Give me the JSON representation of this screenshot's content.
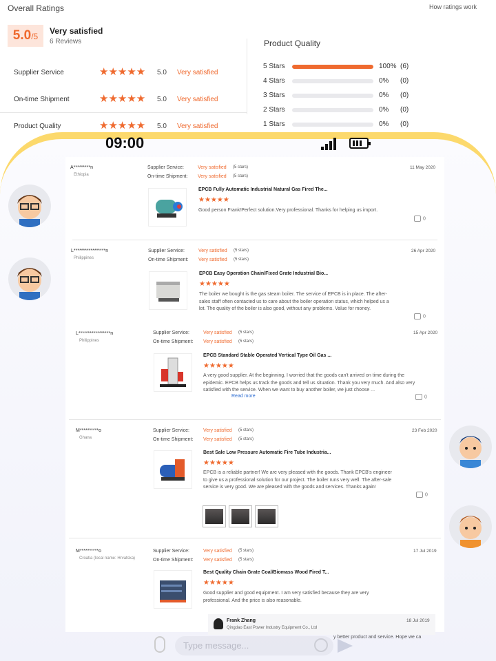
{
  "overall": {
    "title": "Overall Ratings",
    "how_link": "How ratings work",
    "score": "5.0",
    "score_max": "/5",
    "verdict": "Very satisfied",
    "reviews_count": "6 Reviews"
  },
  "criteria": [
    {
      "label": "Supplier Service",
      "stars": 5,
      "value": "5.0",
      "text": "Very satisfied"
    },
    {
      "label": "On-time Shipment",
      "stars": 5,
      "value": "5.0",
      "text": "Very satisfied"
    },
    {
      "label": "Product Quality",
      "stars": 5,
      "value": "5.0",
      "text": "Very satisfied"
    }
  ],
  "product_quality": {
    "title": "Product Quality",
    "rows": [
      {
        "label": "5 Stars",
        "fraction": 1.0,
        "pct": "100%",
        "count": "(6)"
      },
      {
        "label": "4 Stars",
        "fraction": 0,
        "pct": "0%",
        "count": "(0)"
      },
      {
        "label": "3 Stars",
        "fraction": 0,
        "pct": "0%",
        "count": "(0)"
      },
      {
        "label": "2 Stars",
        "fraction": 0,
        "pct": "0%",
        "count": "(0)"
      },
      {
        "label": "1 Stars",
        "fraction": 0,
        "pct": "0%",
        "count": "(0)"
      }
    ]
  },
  "status_bar": {
    "time": "09:00"
  },
  "labels": {
    "supplier_service": "Supplier Service:",
    "ontime_shipment": "On-time Shipment:",
    "very_satisfied": "Very satisfied",
    "five_stars": "(5 stars)",
    "read_more": "Read more"
  },
  "reviews": [
    {
      "user": "A*********n",
      "country": "Ethiopia",
      "date": "11 May 2020",
      "product": "EPCB Fully Automatic Industrial Natural Gas Fired The...",
      "text": "Good person Frank!Perfect solution.Very professional. Thanks for helping us import.",
      "likes": "0"
    },
    {
      "user": "L*****************n",
      "country": "Philippines",
      "date": "26 Apr 2020",
      "product": "EPCB Easy Operation Chain/Fixed Grate Industrial Bio...",
      "text": "The boiler we bought is the gas steam boiler. The service of EPCB is in place. The after-sales staff often contacted us to care about the boiler operation status, which helped us a lot. The quality of the boiler is also good, without any problems. Value for money.",
      "likes": "0"
    },
    {
      "user": "L*****************n",
      "country": "Philippines",
      "date": "15 Apr 2020",
      "product": "EPCB Standard Stable Operated Vertical Type Oil Gas ...",
      "text": "A very good supplier. At the beginning, I worried that the goods can't arrived on time during the epidemic. EPCB helps us track the goods and tell us situation.  Thank you very much. And also very satisfied with the service. When we want to buy another boiler, we just choose ...",
      "likes": "0"
    },
    {
      "user": "M**********o",
      "country": "Ghana",
      "date": "23 Feb 2020",
      "product": "Best Sale Low Pressure Automatic Fire Tube Industria...",
      "text": "EPCB is a reliable partner! We are very pleased with the goods. Thank EPCB's engineer to give us a professional solution for our project. The boiler runs very well. The after-sale service is very good. We are pleased with the goods and services. Thanks again!",
      "likes": "0"
    },
    {
      "user": "M**********o",
      "country": "Croatia (local name: Hrvatska)",
      "date": "17 Jul 2019",
      "product": "Best Quality Chain Grate Coal/Biomass Wood Fired T...",
      "text": "Good supplier and good equipment. I am very satisfied because they are very professional. And the price is also reasonable.",
      "likes": "0"
    }
  ],
  "reply": {
    "name": "Frank Zhang",
    "company": "Qingdao East Power Industry Equipment Co., Ltd",
    "date": "18 Jul 2019",
    "text": "y better product and service. Hope we ca"
  },
  "chat": {
    "placeholder": "Type message..."
  },
  "colors": {
    "accent": "#ef6a2f",
    "phone_frame": "#fcd96c"
  }
}
